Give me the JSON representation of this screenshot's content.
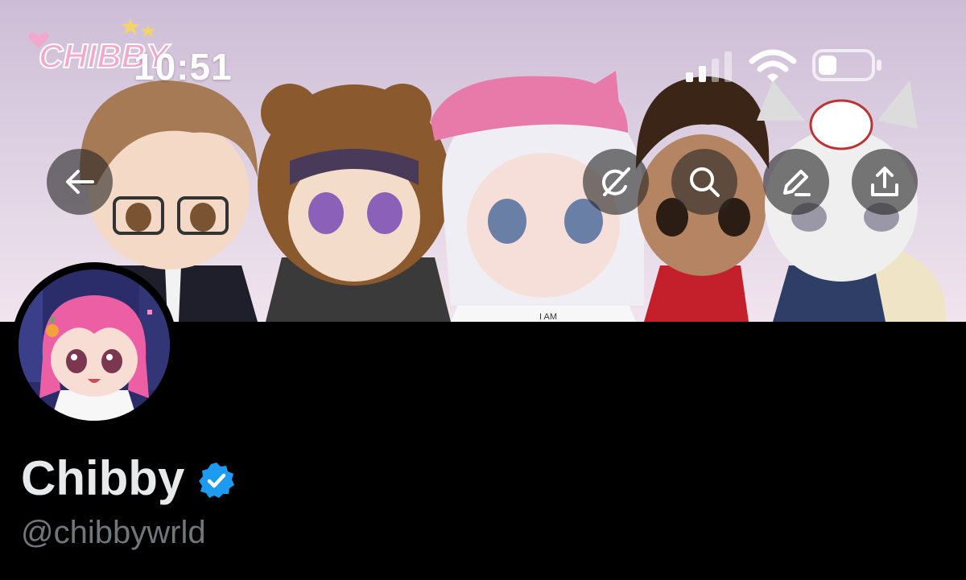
{
  "status_bar": {
    "time": "10:51",
    "signal_icon": "cellular-signal-icon",
    "wifi_icon": "wifi-icon",
    "battery_icon": "battery-low-icon"
  },
  "banner": {
    "logo_text": "CHIBBY",
    "shirt_text": "I AM"
  },
  "nav": {
    "back_icon": "arrow-left-icon",
    "grok_icon": "grok-icon",
    "search_icon": "search-icon",
    "edit_icon": "edit-pencil-icon",
    "share_icon": "share-icon"
  },
  "profile": {
    "display_name": "Chibby",
    "handle": "@chibbywrld",
    "verified_icon": "verified-badge-icon"
  },
  "colors": {
    "background": "#000000",
    "name_text": "#e7e9ea",
    "handle_text": "#71767b",
    "verified_blue": "#1d9bf0",
    "nav_button_bg": "#282828"
  }
}
